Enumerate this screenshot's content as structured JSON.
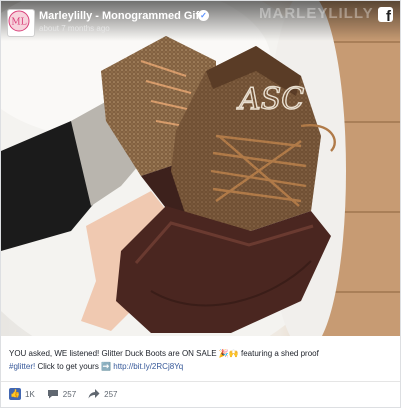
{
  "post": {
    "page_name": "Marleylilly - Monogrammed Gifts",
    "verified_glyph": "✓",
    "timestamp": "about 7 months ago",
    "watermark": "MARLEYLILLY",
    "platform_logo": "f",
    "monogram": "ASC",
    "avatar_text": "ML"
  },
  "caption": {
    "text_1": "YOU asked, WE listened! Glitter Duck Boots are ON SALE ",
    "emoji_1": "🎉🙌",
    "text_2": " featuring a shed proof",
    "hashtag": "#glitter!",
    "text_3": " Click to get yours ",
    "emoji_2": "➡️",
    "text_4": " ",
    "link": "http://bit.ly/2RCj8Yq"
  },
  "stats": {
    "likes": "1K",
    "comments": "257",
    "shares": "257"
  },
  "icons": {
    "verified": "verified-badge-icon",
    "facebook": "facebook-icon",
    "like": "like-icon",
    "comment": "comment-icon",
    "share": "share-icon"
  },
  "colors": {
    "link": "#365899",
    "facebook_blue": "#4267b2",
    "boot_rubber": "#4a2620",
    "boot_suede": "#6b4a30"
  }
}
